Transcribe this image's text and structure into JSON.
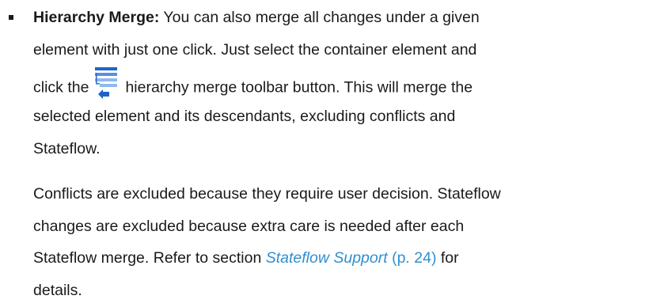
{
  "item": {
    "lead": "Hierarchy Merge:",
    "line1_rest": " You can also merge all changes under a given",
    "line2": "element with just one click. Just select the container element and",
    "line3_pre": "click the",
    "icon": "hierarchy-merge-icon",
    "line3_post": "hierarchy merge toolbar button. This will merge the",
    "line4": "selected element and its descendants, excluding conflicts and",
    "line5": "Stateflow.",
    "p2_line1": "Conflicts are excluded because they require user decision. Stateflow",
    "p2_line2": "changes are excluded because extra care is needed after each",
    "p2_line3_pre": "Stateflow merge. Refer to section ",
    "link_title": "Stateflow Support",
    "link_page": " (p. 24)",
    "p2_line3_post": " for",
    "p2_line4": "details."
  },
  "colors": {
    "link": "#2f8fd0",
    "icon_blue": "#1f63c9",
    "icon_light": "#8fb8ee"
  }
}
